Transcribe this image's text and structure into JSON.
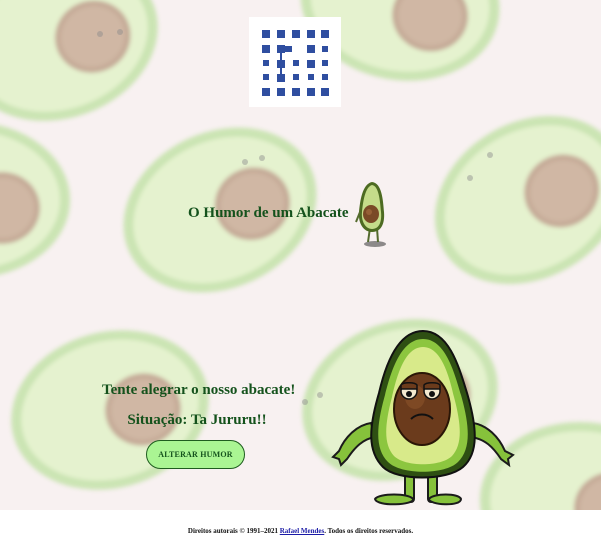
{
  "page": {
    "title": "O Humor de um Abacate",
    "tagline": "Tente alegrar o nosso abacate!",
    "status_label": "Situação:",
    "status_value": "Ta Jururu!!"
  },
  "button": {
    "label": "ALTERAR HUMOR"
  },
  "footer": {
    "prefix": "Direitos autorais © 1991–2021",
    "author": "Rafael Mendes",
    "suffix": ". Todos os direitos reservados."
  },
  "colors": {
    "text_green": "#14521c",
    "button_bg": "#aaf593",
    "link": "#1a1aa6",
    "background": "#f8f1f1"
  },
  "icons": {
    "logo": "qr-code-logo-icon",
    "small_avocado": "walking-avocado-icon",
    "big_avocado": "sad-avocado-icon"
  }
}
